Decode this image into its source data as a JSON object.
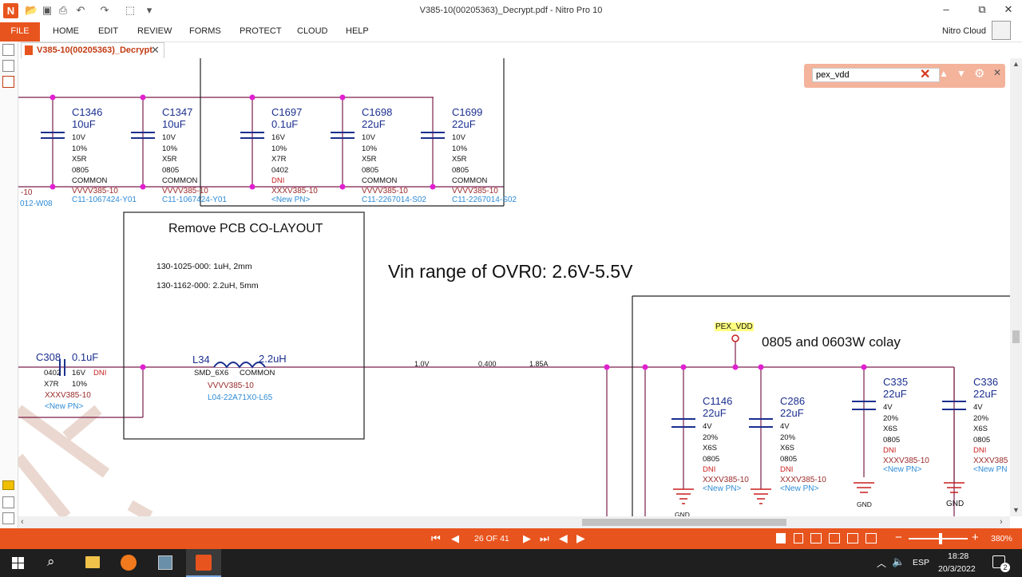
{
  "window": {
    "title": "V385-10(00205363)_Decrypt.pdf - Nitro Pro 10",
    "controls": [
      "–",
      "⧉",
      "✕"
    ]
  },
  "ribbon": {
    "file": "FILE",
    "menus": [
      "HOME",
      "EDIT",
      "REVIEW",
      "FORMS",
      "PROTECT",
      "CLOUD",
      "HELP"
    ],
    "account": "Nitro Cloud"
  },
  "document_tab": {
    "label": "V385-10(00205363)_Decrypt"
  },
  "find": {
    "value": "pex_vdd"
  },
  "schematic": {
    "top_caps": [
      {
        "ref": "C1346",
        "value": "10uF",
        "specs": [
          "10V",
          "10%",
          "X5R",
          "0805",
          "COMMON"
        ],
        "pn": "VVVV385-10",
        "part": "C11-1067424-Y01"
      },
      {
        "ref": "C1347",
        "value": "10uF",
        "specs": [
          "10V",
          "10%",
          "X5R",
          "0805",
          "COMMON"
        ],
        "pn": "VVVV385-10",
        "part": "C11-1067424-Y01"
      },
      {
        "ref": "C1697",
        "value": "0.1uF",
        "specs": [
          "16V",
          "10%",
          "X7R",
          "0402",
          "DNI"
        ],
        "pn": "XXXV385-10",
        "part": "<New PN>"
      },
      {
        "ref": "C1698",
        "value": "22uF",
        "specs": [
          "10V",
          "10%",
          "X5R",
          "0805",
          "COMMON"
        ],
        "pn": "VVVV385-10",
        "part": "C11-2267014-S02"
      },
      {
        "ref": "C1699",
        "value": "22uF",
        "specs": [
          "10V",
          "10%",
          "X5R",
          "0805",
          "COMMON"
        ],
        "pn": "VVVV385-10",
        "part": "C11-2267014-S02"
      }
    ],
    "left_partial": {
      "pn": "-10",
      "part": "012-W08"
    },
    "remove_box": {
      "title": "Remove PCB CO-LAYOUT",
      "line1": "130-1025-000: 1uH, 2mm",
      "line2": "130-1162-000: 2.2uH, 5mm"
    },
    "vin_note": "Vin range of OVR0: 2.6V-5.5V",
    "colay_note": "0805 and 0603W colay",
    "net_label": "PEX_VDD",
    "c308": {
      "ref": "C308",
      "value": "0.1uF",
      "s1": "0402",
      "s2": "16V",
      "s3": "DNI",
      "s4": "X7R",
      "s5": "10%",
      "pn": "XXXV385-10",
      "part": "<New PN>"
    },
    "l34": {
      "ref": "L34",
      "value": "2.2uH",
      "pkg": "SMD_6X6",
      "cat": "COMMON",
      "pn": "VVVV385-10",
      "part": "L04-22A71X0-L65"
    },
    "wire_labels": [
      "1.0V",
      "0.400",
      "1.85A"
    ],
    "bottom_caps": [
      {
        "ref": "C1146",
        "value": "22uF",
        "specs": [
          "4V",
          "20%",
          "X6S",
          "0805",
          "DNI"
        ],
        "pn": "XXXV385-10",
        "part": "<New PN>"
      },
      {
        "ref": "C286",
        "value": "22uF",
        "specs": [
          "4V",
          "20%",
          "X6S",
          "0805",
          "DNI"
        ],
        "pn": "XXXV385-10",
        "part": "<New PN>"
      },
      {
        "ref": "C335",
        "value": "22uF",
        "specs": [
          "4V",
          "20%",
          "X6S",
          "0805",
          "DNI"
        ],
        "pn": "XXXV385-10",
        "part": "<New PN>",
        "gnd": "GND"
      },
      {
        "ref": "C336",
        "value": "22uF",
        "specs": [
          "4V",
          "20%",
          "X6S",
          "0805",
          "DNI"
        ],
        "pn": "XXXV385",
        "part": "<New PN",
        "gnd": "GND"
      }
    ],
    "gnd_partial": "GND"
  },
  "status": {
    "page": "26 OF 41",
    "zoom": "380%"
  },
  "taskbar": {
    "lang": "ESP",
    "time": "18:28",
    "date": "20/3/2022",
    "notif": "2"
  },
  "colors": {
    "accent": "#e8541e",
    "wire": "#7a1f4a",
    "junction": "#e020d0",
    "cap": "#1b2f8e"
  }
}
